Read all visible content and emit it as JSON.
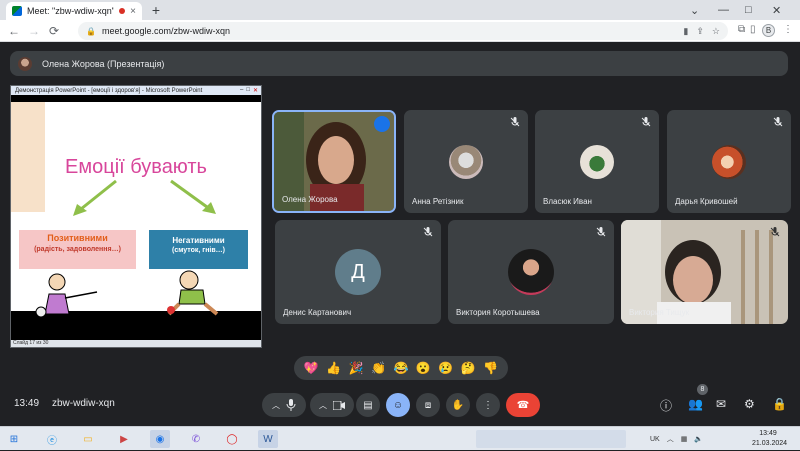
{
  "browser": {
    "tab_title": "Meet: \"zbw-wdiw-xqn\"",
    "tab_close": "×",
    "new_tab": "+",
    "url": "meet.google.com/zbw-wdiw-xqn",
    "profile_initial": "B",
    "win_minimize": "—",
    "win_maximize": "□",
    "win_close": "✕",
    "tab_chevron": "⌄"
  },
  "presenter_bar": {
    "label": "Олена Жорова (Презентація)"
  },
  "slide_window": {
    "title": "Демонстрація PowerPoint - [емоції і здоров'я] - Microsoft PowerPoint",
    "status": "Слайд 17 из 30",
    "slide": {
      "heading": "Емоції бувають",
      "positive_title": "Позитивними",
      "positive_sub": "(радість, задоволення…)",
      "negative_title": "Негативними",
      "negative_sub": "(смуток, гнів…)"
    }
  },
  "participants": [
    {
      "name": "Олена Жорова",
      "initial": "",
      "speaking": true
    },
    {
      "name": "Анна Ретізник",
      "initial": "",
      "muted": true
    },
    {
      "name": "Власюк Иван",
      "initial": "",
      "muted": true
    },
    {
      "name": "Дарья Кривошей",
      "initial": "",
      "muted": true
    },
    {
      "name": "Денис Картанович",
      "initial": "Д",
      "muted": true
    },
    {
      "name": "Виктория Коротышева",
      "initial": "",
      "muted": true
    },
    {
      "name": "Виктория Тищук",
      "initial": "",
      "muted": true
    }
  ],
  "reactions": [
    "💖",
    "👍",
    "🎉",
    "👏",
    "😂",
    "😮",
    "😢",
    "🤔",
    "👎"
  ],
  "controls": {
    "time": "13:49",
    "meeting_code": "zbw-wdiw-xqn",
    "people_count": "8"
  },
  "taskbar": {
    "lang": "UK",
    "time": "13:49",
    "date": "21.03.2024"
  },
  "colors": {
    "meet_bg": "#202124",
    "tile_bg": "#3c4043",
    "accent": "#8ab4f8",
    "hangup": "#ea4335",
    "slide_heading": "#d8469b"
  }
}
